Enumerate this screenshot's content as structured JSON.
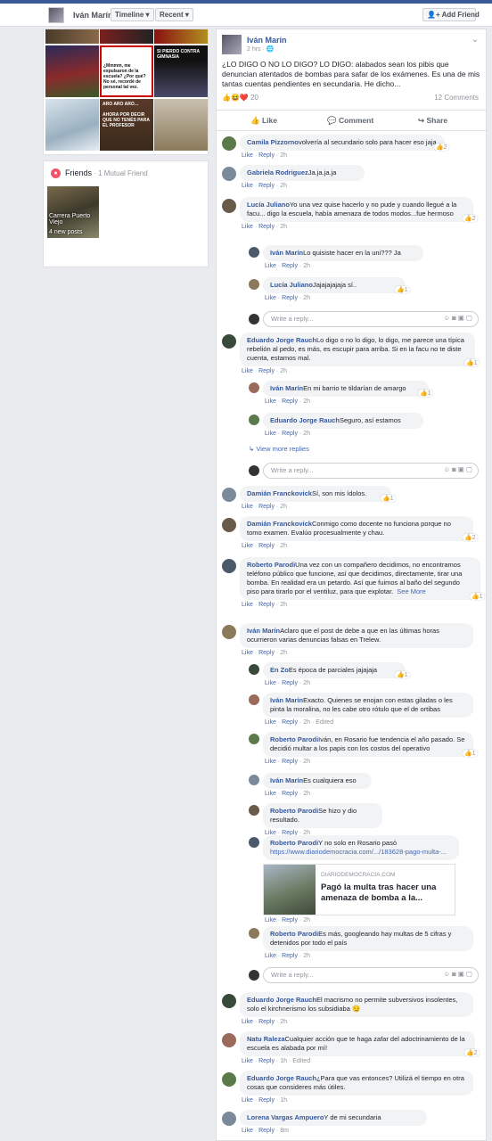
{
  "header": {
    "name": "Iván Marín",
    "timeline": "Timeline ▾",
    "recent": "Recent ▾",
    "add_friend": "Add Friend"
  },
  "photos": [
    {
      "text": "¿Mmmm, me expulsaron de la escuela? ¿Por qué? No sé, recordé de personal tal vez."
    },
    {
      "text": "SI PIERDO CONTRA GIMNASIA"
    },
    {
      "text": "ARO ARO ARO…"
    },
    {
      "text": "AHORA POR DECIR QUE NO TENÉS PARA EL PROFESOR"
    }
  ],
  "friends": {
    "title": "Friends",
    "mutual": " · 1 Mutual Friend",
    "card_name": "Carrera Puerto Viejo",
    "card_posts": "4 new posts"
  },
  "post": {
    "author": "Iván Marín",
    "time": "2 hrs · ",
    "text": "¿LO DIGO O NO LO DIGO? LO DIGO: alabados sean los pibis que denuncian atentados de bombas para safar de los exámenes. Es una de mis tantas cuentas pendientes en secundaria. He dicho...",
    "reactions": "20",
    "comments": "12 Comments",
    "like": "Like",
    "comment": "Comment",
    "share": "Share"
  },
  "comments": [
    {
      "name": "Camila Pizzorno",
      "text": "volvería al secundario solo para hacer eso jaja",
      "time": "2h",
      "react": "2"
    },
    {
      "name": "Gabriela Rodriguez",
      "text": "Ja.ja.ja.ja",
      "time": "2h"
    },
    {
      "name": "Lucía Juliano",
      "text": "Yo una vez quise hacerlo y no pude y cuando llegué a la facu... digo la escuela, había amenaza de todos modos...fue hermoso",
      "time": "2h",
      "react": "2"
    },
    {
      "name": "Iván Marín",
      "text": "Lo quisiste hacer en la uni??? Ja",
      "time": "2h"
    },
    {
      "name": "Lucía Juliano",
      "text": "Jajajajajaja sí..",
      "time": "2h",
      "react": "1"
    },
    {
      "name": "Eduardo Jorge Rauch",
      "text": "Lo digo o no lo digo, lo digo, me parece una típica rebelión al pedo, es más, es escupir para arriba. Si en la facu no te diste cuenta, estamos mal.",
      "time": "2h",
      "react": "1"
    },
    {
      "name": "Iván Marín",
      "text": "En mi barrio te tildarían de amargo",
      "time": "2h",
      "react": "1"
    },
    {
      "name": "Eduardo Jorge Rauch",
      "text": "Seguro, así estamos",
      "time": "2h"
    },
    {
      "name": "Damián Franckovick",
      "text": "Sí, son mis ídolos.",
      "time": "2h",
      "react": "1"
    },
    {
      "name": "Damián Franckovick",
      "text": "Conmigo como docente no funciona porque no tomo examen. Evalúo procesualmente y chau.",
      "time": "2h",
      "react": "2"
    },
    {
      "name": "Roberto Parodi",
      "text": "Una vez con un compañero decidimos, no encontramos teléfono público que funcione, así que decidimos, directamente, tirar una bomba. En realidad era un petardo. Así que fuimos al baño del segundo piso para tirarlo por el ventiluz, para que explotar.",
      "more": "See More",
      "time": "2h",
      "react": "1"
    },
    {
      "name": "Iván Marín",
      "text": "Aclaro que el post de debe a que en las últimas horas ocurrieron varias denuncias falsas en Trelew.",
      "time": "2h"
    },
    {
      "name": "En Zo",
      "text": "Es época de parciales jajajaja",
      "time": "2h",
      "react": "1"
    },
    {
      "name": "Iván Marín",
      "text": "Exacto. Quienes se enojan con estas giladas o les pinta la moralina, no les cabe otro rótulo que el de ortibas",
      "time": "2h",
      "edited": "Edited"
    },
    {
      "name": "Roberto Parodi",
      "text": "Iván, en Rosario fue tendencia el año pasado. Se decidió multar a los papis con los costos del operativo",
      "time": "2h",
      "react": "1"
    },
    {
      "name": "Iván Marín",
      "text": "Es cualquiera eso",
      "time": "2h"
    },
    {
      "name": "Roberto Parodi",
      "text": "Se hizo y dio resultado.",
      "time": "2h"
    },
    {
      "name": "Roberto Parodi",
      "text": "Y no solo en Rosario pasó",
      "link": "https://www.diariodemocracia.com/.../183628-pago-multa-...",
      "card_src": "DIARIODEMOCRACIA.COM",
      "card_title": "Pagó la multa tras hacer una amenaza de bomba a la...",
      "time": "2h"
    },
    {
      "name": "Roberto Parodi",
      "text": "Es más, googleando hay multas de 5 cifras y detenidos por todo el país",
      "time": "2h"
    },
    {
      "name": "Eduardo Jorge Rauch",
      "text": "El macrismo no permite subversivos insolentes, solo el kirchnerismo los subsidiaba 😏",
      "time": "2h"
    },
    {
      "name": "Natu Raleza",
      "text": "Cualquier acción que te haga zafar del adoctrinamiento de la escuela es alabada por mí!",
      "time": "1h",
      "edited": "Edited",
      "react": "2"
    },
    {
      "name": "Eduardo Jorge Rauch",
      "text": "¿Para que vas entonces? Utilizá el tiempo en otra cosas que consideres más útiles.",
      "time": "1h"
    },
    {
      "name": "Lorena Vargas Ampuero",
      "text": "Y de mi secundaria",
      "time": "8m"
    }
  ],
  "labels": {
    "like": "Like",
    "reply": "Reply",
    "write_reply": "Write a reply...",
    "view_more": "View more replies"
  },
  "colors": {
    "brand": "#3b5998",
    "link": "#365899"
  }
}
